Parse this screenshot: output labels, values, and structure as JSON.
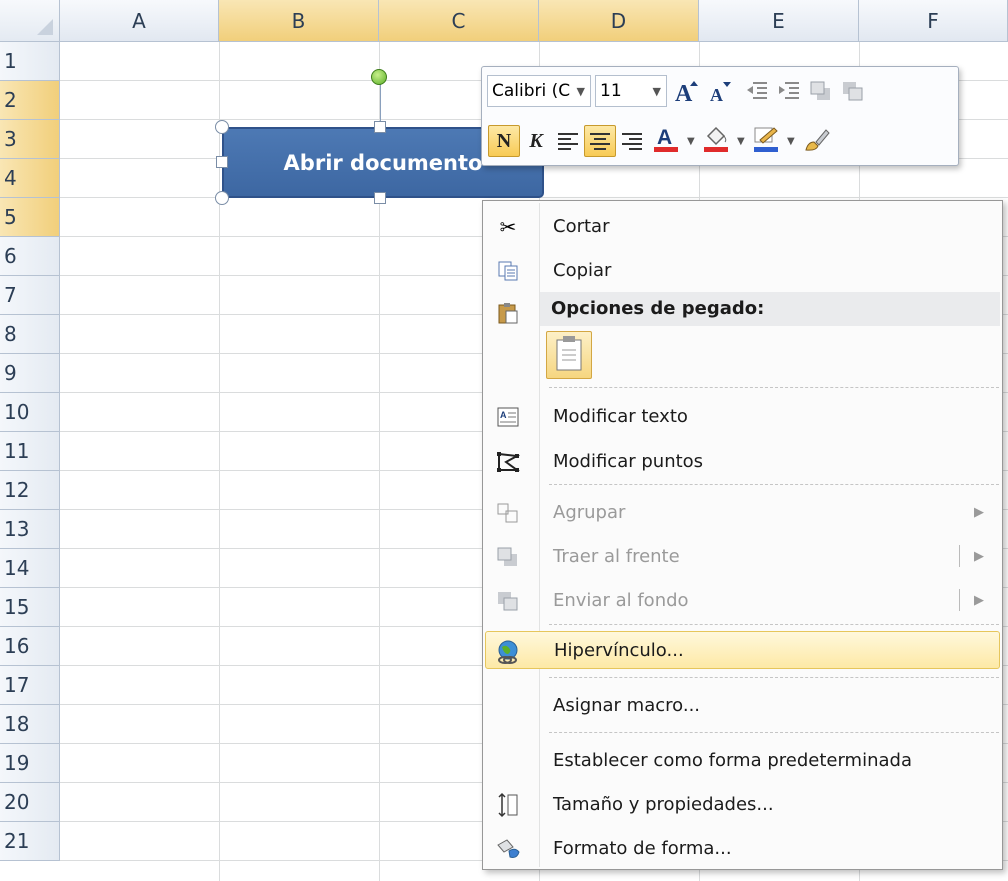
{
  "columns": [
    "A",
    "B",
    "C",
    "D",
    "E",
    "F"
  ],
  "rows": [
    "1",
    "2",
    "3",
    "4",
    "5",
    "6",
    "7",
    "8",
    "9",
    "10",
    "11",
    "12",
    "13",
    "14",
    "15",
    "16",
    "17",
    "18",
    "19",
    "20",
    "21"
  ],
  "shape": {
    "text": "Abrir documento"
  },
  "mini_toolbar": {
    "font_name": "Calibri (C",
    "font_size": "11",
    "bold_label": "N",
    "italic_label": "K",
    "font_color": "#e02b2b",
    "fill_color": "#e02b2b",
    "line_color": "#2f5fd0"
  },
  "context_menu": {
    "cut": "Cortar",
    "copy": "Copiar",
    "paste_options_header": "Opciones de pegado:",
    "edit_text": "Modificar texto",
    "edit_points": "Modificar puntos",
    "group": "Agrupar",
    "bring_to_front": "Traer al frente",
    "send_to_back": "Enviar al fondo",
    "hyperlink": "Hipervínculo...",
    "assign_macro": "Asignar macro...",
    "set_default_shape": "Establecer como forma predeterminada",
    "size_properties": "Tamaño y propiedades...",
    "format_shape": "Formato de forma..."
  }
}
